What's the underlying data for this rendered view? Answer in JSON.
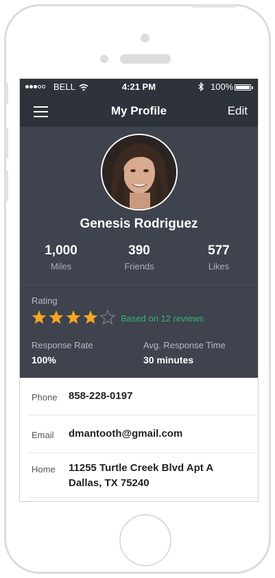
{
  "status_bar": {
    "carrier": "BELL",
    "time": "4:21 PM",
    "battery": "100%"
  },
  "nav": {
    "title": "My Profile",
    "edit_label": "Edit"
  },
  "profile": {
    "name": "Genesis Rodriguez",
    "stats": [
      {
        "value": "1,000",
        "label": "Miles"
      },
      {
        "value": "390",
        "label": "Friends"
      },
      {
        "value": "577",
        "label": "Likes"
      }
    ],
    "rating": {
      "label": "Rating",
      "stars_filled": 4,
      "stars_total": 5,
      "reviews_text": "Based on 12 reviews"
    },
    "response_rate": {
      "label": "Response Rate",
      "value": "100%"
    },
    "avg_response_time": {
      "label": "Avg. Response Time",
      "value": "30 minutes"
    }
  },
  "details": [
    {
      "label": "Phone",
      "value": "858-228-0197"
    },
    {
      "label": "Email",
      "value": "dmantooth@gmail.com"
    },
    {
      "label": "Home",
      "value": "11255 Turtle Creek Blvd Apt A Dallas, TX 75240"
    }
  ],
  "colors": {
    "dark_bg": "#3e434d",
    "bar_bg": "#2e323a",
    "star": "#f5a623",
    "reviews_green": "#3db07a"
  },
  "icons": [
    "signal-icon",
    "wifi-icon",
    "bluetooth-icon",
    "battery-icon",
    "hamburger-menu-icon",
    "star-icon"
  ]
}
